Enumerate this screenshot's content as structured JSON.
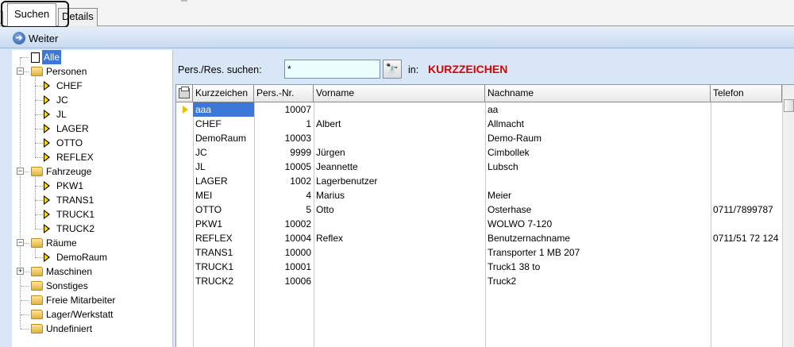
{
  "tabs": [
    {
      "label": "Suchen",
      "active": true
    },
    {
      "label": "Details",
      "active": false
    }
  ],
  "toolbar": {
    "weiter_label": "Weiter"
  },
  "tree": {
    "items": [
      {
        "label": "Alle",
        "level": 0,
        "kind": "all",
        "selected": true
      },
      {
        "label": "Personen",
        "level": 0,
        "kind": "folder",
        "expander": "−"
      },
      {
        "label": "CHEF",
        "level": 1,
        "kind": "leaf"
      },
      {
        "label": "JC",
        "level": 1,
        "kind": "leaf"
      },
      {
        "label": "JL",
        "level": 1,
        "kind": "leaf"
      },
      {
        "label": "LAGER",
        "level": 1,
        "kind": "leaf"
      },
      {
        "label": "OTTO",
        "level": 1,
        "kind": "leaf"
      },
      {
        "label": "REFLEX",
        "level": 1,
        "kind": "leaf"
      },
      {
        "label": "Fahrzeuge",
        "level": 0,
        "kind": "folder",
        "expander": "−"
      },
      {
        "label": "PKW1",
        "level": 1,
        "kind": "leaf"
      },
      {
        "label": "TRANS1",
        "level": 1,
        "kind": "leaf"
      },
      {
        "label": "TRUCK1",
        "level": 1,
        "kind": "leaf"
      },
      {
        "label": "TRUCK2",
        "level": 1,
        "kind": "leaf"
      },
      {
        "label": "Räume",
        "level": 0,
        "kind": "folder",
        "expander": "−"
      },
      {
        "label": "DemoRaum",
        "level": 1,
        "kind": "leaf"
      },
      {
        "label": "Maschinen",
        "level": 0,
        "kind": "folder",
        "expander": "+"
      },
      {
        "label": "Sonstiges",
        "level": 0,
        "kind": "folder"
      },
      {
        "label": "Freie Mitarbeiter",
        "level": 0,
        "kind": "folder"
      },
      {
        "label": "Lager/Werkstatt",
        "level": 0,
        "kind": "folder"
      },
      {
        "label": "Undefiniert",
        "level": 0,
        "kind": "folder"
      }
    ]
  },
  "search": {
    "label": "Pers./Res. suchen:",
    "value": "*",
    "in_label": "in:",
    "field": "KURZZEICHEN"
  },
  "grid": {
    "columns": [
      "Kurzzeichen",
      "Pers.-Nr.",
      "Vorname",
      "Nachname",
      "Telefon"
    ],
    "rows": [
      [
        "aaa",
        "10007",
        "",
        "aa",
        ""
      ],
      [
        "CHEF",
        "1",
        "Albert",
        "Allmacht",
        ""
      ],
      [
        "DemoRaum",
        "10003",
        "",
        "Demo-Raum",
        ""
      ],
      [
        "JC",
        "9999",
        "Jürgen",
        "Cimbollek",
        ""
      ],
      [
        "JL",
        "10005",
        "Jeannette",
        "Lubsch",
        ""
      ],
      [
        "LAGER",
        "1002",
        "Lagerbenutzer",
        "",
        ""
      ],
      [
        "MEI",
        "4",
        "Marius",
        "Meier",
        ""
      ],
      [
        "OTTO",
        "5",
        "Otto",
        "Osterhase",
        "0711/7899787"
      ],
      [
        "PKW1",
        "10002",
        "",
        "WOLWO 7-120",
        ""
      ],
      [
        "REFLEX",
        "10004",
        "Reflex",
        "Benutzernachname",
        "0711/51 72 124"
      ],
      [
        "TRANS1",
        "10000",
        "",
        "Transporter 1 MB 207",
        ""
      ],
      [
        "TRUCK1",
        "10001",
        "",
        "Truck1 38 to",
        ""
      ],
      [
        "TRUCK2",
        "10006",
        "",
        "Truck2",
        ""
      ]
    ],
    "selected_row": 0
  },
  "colors": {
    "selection": "#3b78d8",
    "field_label": "#e00000",
    "search_input_bg": "#ecfdfd"
  }
}
